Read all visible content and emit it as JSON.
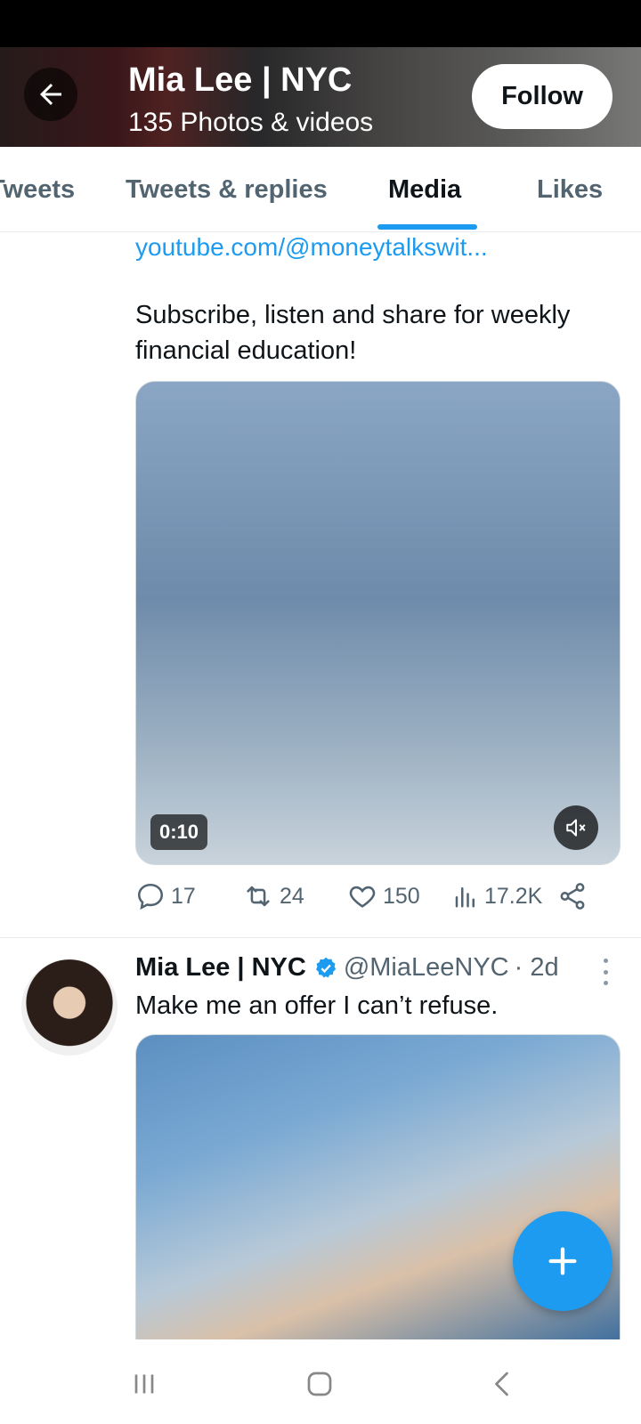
{
  "header": {
    "title": "Mia Lee | NYC",
    "subtitle": "135 Photos & videos",
    "follow_label": "Follow"
  },
  "tabs": [
    {
      "label": "Tweets"
    },
    {
      "label": "Tweets & replies"
    },
    {
      "label": "Media",
      "active": true
    },
    {
      "label": "Likes"
    }
  ],
  "tweet1": {
    "link": "youtube.com/@moneytalkswit...",
    "text": "Subscribe, listen and share for weekly financial education!",
    "video_duration": "0:10",
    "replies": "17",
    "retweets": "24",
    "likes": "150",
    "views": "17.2K"
  },
  "tweet2": {
    "name": "Mia Lee | NYC",
    "handle": "@MiaLeeNYC",
    "time": "· 2d",
    "text": "Make me an offer I can’t refuse."
  },
  "colors": {
    "accent": "#1d9bf0",
    "text_primary": "#0f1419",
    "text_secondary": "#536471"
  },
  "icons": [
    "arrow-left-icon",
    "mute-icon",
    "reply-icon",
    "retweet-icon",
    "heart-icon",
    "views-icon",
    "share-icon",
    "verified-icon",
    "more-icon",
    "plus-icon",
    "recents-icon",
    "home-icon",
    "back-nav-icon"
  ]
}
